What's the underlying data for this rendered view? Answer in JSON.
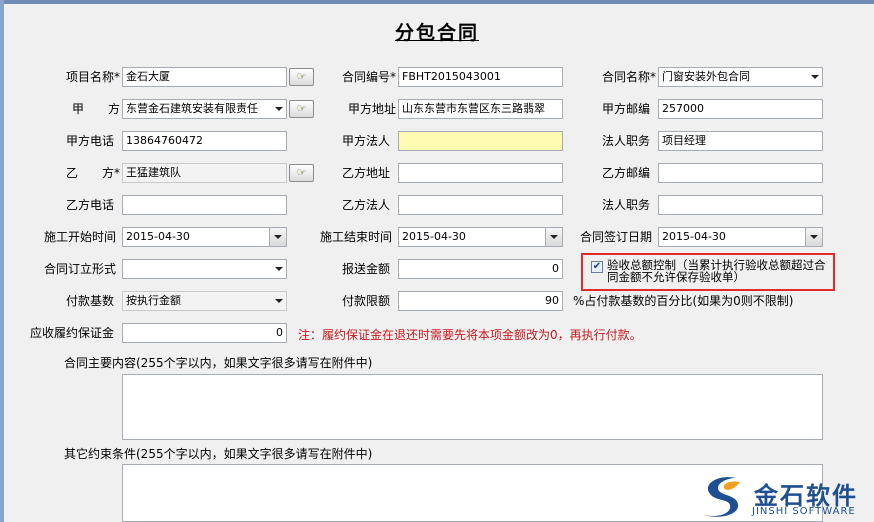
{
  "form": {
    "title": "分包合同",
    "project_name": {
      "label": "项目名称*",
      "value": "金石大厦"
    },
    "contract_no": {
      "label": "合同编号*",
      "value": "FBHT2015043001"
    },
    "contract_name": {
      "label": "合同名称*",
      "value": "门窗安装外包合同"
    },
    "party_a": {
      "label": "甲　　方",
      "value": "东营金石建筑安装有限责任"
    },
    "party_a_address": {
      "label": "甲方地址",
      "value": "山东东营市东营区东三路翡翠"
    },
    "party_a_zip": {
      "label": "甲方邮编",
      "value": "257000"
    },
    "party_a_phone": {
      "label": "甲方电话",
      "value": "13864760472"
    },
    "party_a_legal": {
      "label": "甲方法人",
      "value": ""
    },
    "legal_title": {
      "label": "法人职务",
      "value": "项目经理"
    },
    "party_b": {
      "label": "乙　　方*",
      "value": "王猛建筑队"
    },
    "party_b_address": {
      "label": "乙方地址",
      "value": ""
    },
    "party_b_zip": {
      "label": "乙方邮编",
      "value": ""
    },
    "party_b_phone": {
      "label": "乙方电话",
      "value": ""
    },
    "party_b_legal": {
      "label": "乙方法人",
      "value": ""
    },
    "party_b_legal_title": {
      "label": "法人职务",
      "value": ""
    },
    "start_date": {
      "label": "施工开始时间",
      "value": "2015-04-30"
    },
    "end_date": {
      "label": "施工结束时间",
      "value": "2015-04-30"
    },
    "sign_date": {
      "label": "合同签订日期",
      "value": "2015-04-30"
    },
    "contract_form": {
      "label": "合同订立形式",
      "value": ""
    },
    "reported_amount": {
      "label": "报送金额",
      "value": "0"
    },
    "acceptance_check": {
      "checked": true,
      "label": "验收总额控制（当累计执行验收总额超过合同金额不允许保存验收单）"
    },
    "payment_base": {
      "label": "付款基数",
      "value": "按执行金额"
    },
    "payment_limit": {
      "label": "付款限额",
      "value": "90",
      "note": "%占付款基数的百分比(如果为0则不限制)"
    },
    "deposit": {
      "label": "应收履约保证金",
      "value": "0",
      "note": "注：履约保证金在退还时需要先将本项金额改为0，再执行付款。"
    },
    "main_content_label": "合同主要内容(255个字以内，如果文字很多请写在附件中)",
    "other_terms_label": "其它约束条件(255个字以内，如果文字很多请写在附件中)"
  },
  "logo": {
    "text": "金石软件",
    "sub": "JINSHI SOFTWARE"
  },
  "icons": {
    "picker": "hand-pointer-icon",
    "dropdown": "chevron-down-icon",
    "checkbox": "checkmark-icon"
  },
  "colors": {
    "highlight_border": "#e02b2b",
    "required_field_bg": "#fffbb3",
    "note_text": "#c8191e",
    "logo": "#1d4f92"
  }
}
